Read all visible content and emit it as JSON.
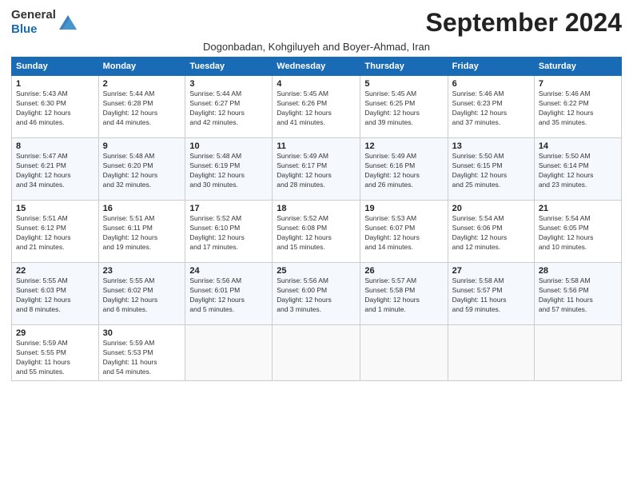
{
  "header": {
    "logo_general": "General",
    "logo_blue": "Blue",
    "month_title": "September 2024",
    "subtitle": "Dogonbadan, Kohgiluyeh and Boyer-Ahmad, Iran"
  },
  "weekdays": [
    "Sunday",
    "Monday",
    "Tuesday",
    "Wednesday",
    "Thursday",
    "Friday",
    "Saturday"
  ],
  "weeks": [
    [
      {
        "day": "1",
        "info": "Sunrise: 5:43 AM\nSunset: 6:30 PM\nDaylight: 12 hours\nand 46 minutes."
      },
      {
        "day": "2",
        "info": "Sunrise: 5:44 AM\nSunset: 6:28 PM\nDaylight: 12 hours\nand 44 minutes."
      },
      {
        "day": "3",
        "info": "Sunrise: 5:44 AM\nSunset: 6:27 PM\nDaylight: 12 hours\nand 42 minutes."
      },
      {
        "day": "4",
        "info": "Sunrise: 5:45 AM\nSunset: 6:26 PM\nDaylight: 12 hours\nand 41 minutes."
      },
      {
        "day": "5",
        "info": "Sunrise: 5:45 AM\nSunset: 6:25 PM\nDaylight: 12 hours\nand 39 minutes."
      },
      {
        "day": "6",
        "info": "Sunrise: 5:46 AM\nSunset: 6:23 PM\nDaylight: 12 hours\nand 37 minutes."
      },
      {
        "day": "7",
        "info": "Sunrise: 5:46 AM\nSunset: 6:22 PM\nDaylight: 12 hours\nand 35 minutes."
      }
    ],
    [
      {
        "day": "8",
        "info": "Sunrise: 5:47 AM\nSunset: 6:21 PM\nDaylight: 12 hours\nand 34 minutes."
      },
      {
        "day": "9",
        "info": "Sunrise: 5:48 AM\nSunset: 6:20 PM\nDaylight: 12 hours\nand 32 minutes."
      },
      {
        "day": "10",
        "info": "Sunrise: 5:48 AM\nSunset: 6:19 PM\nDaylight: 12 hours\nand 30 minutes."
      },
      {
        "day": "11",
        "info": "Sunrise: 5:49 AM\nSunset: 6:17 PM\nDaylight: 12 hours\nand 28 minutes."
      },
      {
        "day": "12",
        "info": "Sunrise: 5:49 AM\nSunset: 6:16 PM\nDaylight: 12 hours\nand 26 minutes."
      },
      {
        "day": "13",
        "info": "Sunrise: 5:50 AM\nSunset: 6:15 PM\nDaylight: 12 hours\nand 25 minutes."
      },
      {
        "day": "14",
        "info": "Sunrise: 5:50 AM\nSunset: 6:14 PM\nDaylight: 12 hours\nand 23 minutes."
      }
    ],
    [
      {
        "day": "15",
        "info": "Sunrise: 5:51 AM\nSunset: 6:12 PM\nDaylight: 12 hours\nand 21 minutes."
      },
      {
        "day": "16",
        "info": "Sunrise: 5:51 AM\nSunset: 6:11 PM\nDaylight: 12 hours\nand 19 minutes."
      },
      {
        "day": "17",
        "info": "Sunrise: 5:52 AM\nSunset: 6:10 PM\nDaylight: 12 hours\nand 17 minutes."
      },
      {
        "day": "18",
        "info": "Sunrise: 5:52 AM\nSunset: 6:08 PM\nDaylight: 12 hours\nand 15 minutes."
      },
      {
        "day": "19",
        "info": "Sunrise: 5:53 AM\nSunset: 6:07 PM\nDaylight: 12 hours\nand 14 minutes."
      },
      {
        "day": "20",
        "info": "Sunrise: 5:54 AM\nSunset: 6:06 PM\nDaylight: 12 hours\nand 12 minutes."
      },
      {
        "day": "21",
        "info": "Sunrise: 5:54 AM\nSunset: 6:05 PM\nDaylight: 12 hours\nand 10 minutes."
      }
    ],
    [
      {
        "day": "22",
        "info": "Sunrise: 5:55 AM\nSunset: 6:03 PM\nDaylight: 12 hours\nand 8 minutes."
      },
      {
        "day": "23",
        "info": "Sunrise: 5:55 AM\nSunset: 6:02 PM\nDaylight: 12 hours\nand 6 minutes."
      },
      {
        "day": "24",
        "info": "Sunrise: 5:56 AM\nSunset: 6:01 PM\nDaylight: 12 hours\nand 5 minutes."
      },
      {
        "day": "25",
        "info": "Sunrise: 5:56 AM\nSunset: 6:00 PM\nDaylight: 12 hours\nand 3 minutes."
      },
      {
        "day": "26",
        "info": "Sunrise: 5:57 AM\nSunset: 5:58 PM\nDaylight: 12 hours\nand 1 minute."
      },
      {
        "day": "27",
        "info": "Sunrise: 5:58 AM\nSunset: 5:57 PM\nDaylight: 11 hours\nand 59 minutes."
      },
      {
        "day": "28",
        "info": "Sunrise: 5:58 AM\nSunset: 5:56 PM\nDaylight: 11 hours\nand 57 minutes."
      }
    ],
    [
      {
        "day": "29",
        "info": "Sunrise: 5:59 AM\nSunset: 5:55 PM\nDaylight: 11 hours\nand 55 minutes."
      },
      {
        "day": "30",
        "info": "Sunrise: 5:59 AM\nSunset: 5:53 PM\nDaylight: 11 hours\nand 54 minutes."
      },
      {
        "day": "",
        "info": ""
      },
      {
        "day": "",
        "info": ""
      },
      {
        "day": "",
        "info": ""
      },
      {
        "day": "",
        "info": ""
      },
      {
        "day": "",
        "info": ""
      }
    ]
  ]
}
